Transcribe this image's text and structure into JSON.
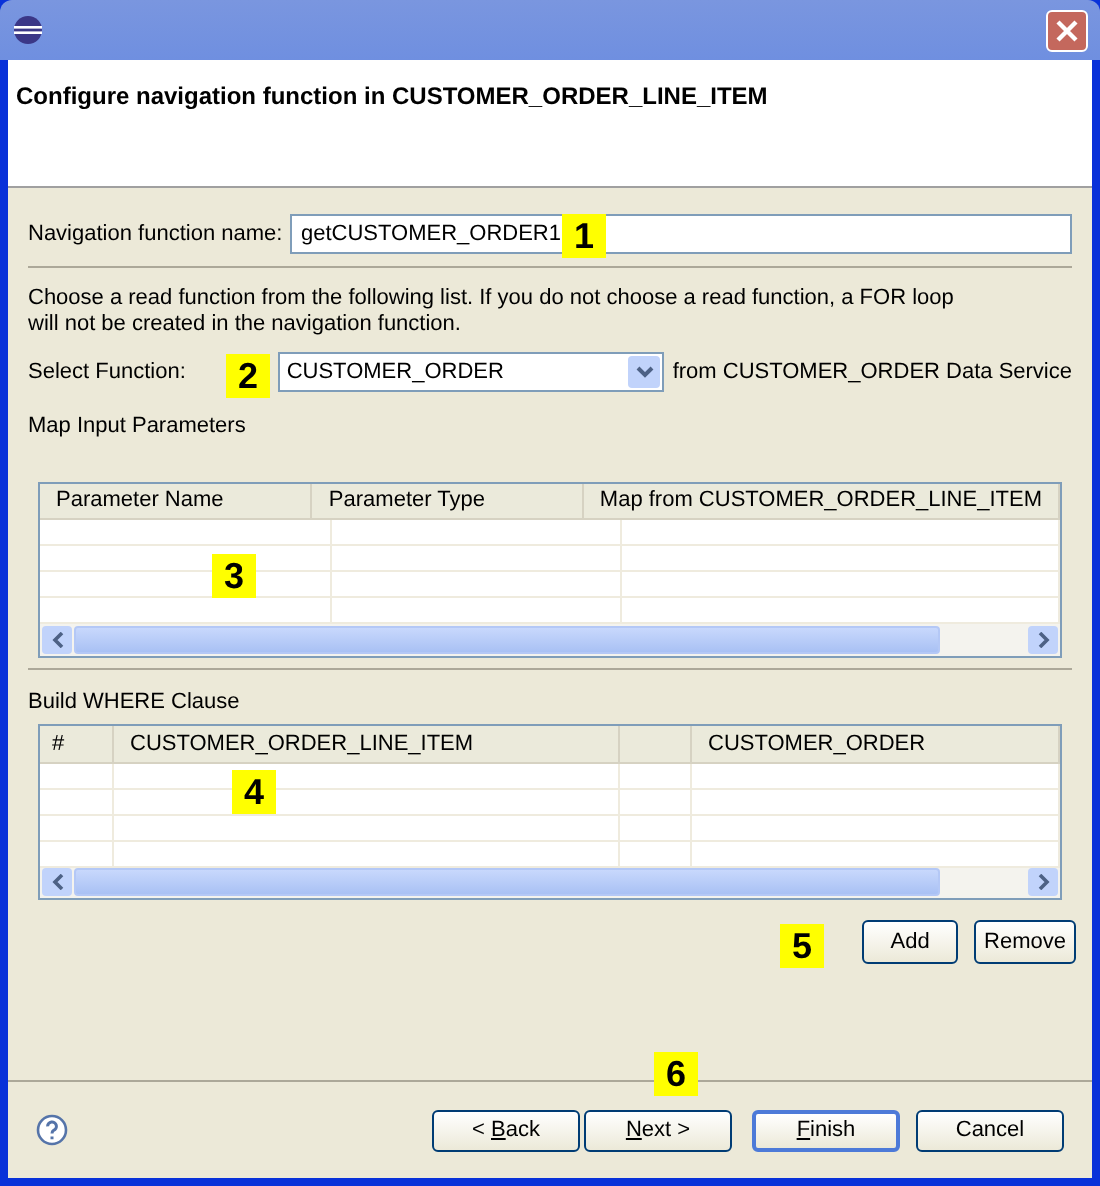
{
  "window": {
    "title_banner": "Configure navigation function in CUSTOMER_ORDER_LINE_ITEM"
  },
  "name_field": {
    "label": "Navigation function name:",
    "value": "getCUSTOMER_ORDER1"
  },
  "instructions": [
    "Choose a read function from the following list.  If you do not choose a read function, a FOR loop",
    "will not be created in the navigation function."
  ],
  "select_function": {
    "label": "Select Function:",
    "value": "CUSTOMER_ORDER",
    "suffix": "from CUSTOMER_ORDER Data Service"
  },
  "input_parameters": {
    "title": "Map Input Parameters",
    "columns": [
      "Parameter Name",
      "Parameter Type",
      "Map from CUSTOMER_ORDER_LINE_ITEM"
    ]
  },
  "where_clause": {
    "title": "Build WHERE Clause",
    "columns": [
      "#",
      "CUSTOMER_ORDER_LINE_ITEM",
      null,
      "CUSTOMER_ORDER"
    ],
    "buttons": [
      "Add",
      "Remove"
    ]
  },
  "footer_buttons": [
    {
      "before": "< ",
      "key": "B",
      "after": "ack",
      "default": false
    },
    {
      "key": "N",
      "after": "ext >",
      "default": false
    },
    {
      "key": "F",
      "after": "inish",
      "default": true
    },
    {
      "before": "Cancel",
      "default": false
    }
  ],
  "callouts": [
    "1",
    "2",
    "3",
    "4",
    "5",
    "6"
  ]
}
